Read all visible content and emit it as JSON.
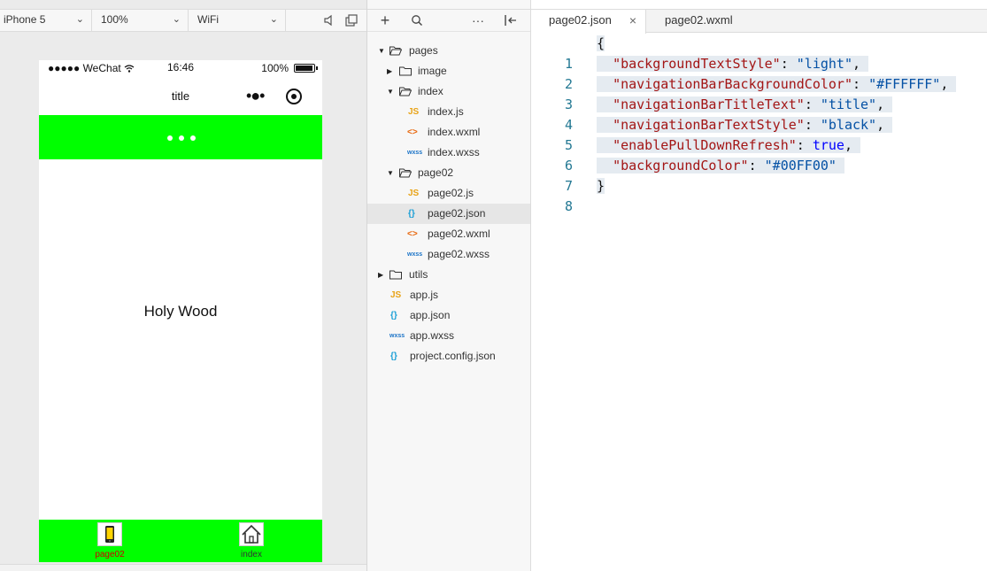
{
  "simulator": {
    "device": "iPhone 5",
    "zoom": "100%",
    "network": "WiFi",
    "statusbar": {
      "carrier": "●●●●● WeChat",
      "time": "16:46",
      "battery": "100%"
    },
    "navbar": {
      "title": "title",
      "menu_dots": "•●•"
    },
    "content_text": "Holy Wood",
    "colors": {
      "accent": "#00FF00",
      "tab_label_active": "#cc0000",
      "tab_label_inactive": "#333333"
    },
    "tabbar": [
      {
        "label": "page02",
        "icon": "phone-icon",
        "active": true
      },
      {
        "label": "index",
        "icon": "home-icon",
        "active": false
      }
    ]
  },
  "explorer": {
    "toolbar": {
      "add": "+",
      "more": "···"
    },
    "tree": [
      {
        "label": "pages",
        "type": "folder",
        "expanded": true,
        "depth": 0
      },
      {
        "label": "image",
        "type": "folder",
        "expanded": false,
        "depth": 1
      },
      {
        "label": "index",
        "type": "folder",
        "expanded": true,
        "depth": 1
      },
      {
        "label": "index.js",
        "type": "js",
        "depth": 2,
        "badge": "JS"
      },
      {
        "label": "index.wxml",
        "type": "wxml",
        "depth": 2,
        "badge": "<>"
      },
      {
        "label": "index.wxss",
        "type": "wxss",
        "depth": 2,
        "badge": "wxss"
      },
      {
        "label": "page02",
        "type": "folder",
        "expanded": true,
        "depth": 1
      },
      {
        "label": "page02.js",
        "type": "js",
        "depth": 2,
        "badge": "JS"
      },
      {
        "label": "page02.json",
        "type": "json",
        "depth": 2,
        "badge": "{}",
        "selected": true
      },
      {
        "label": "page02.wxml",
        "type": "wxml",
        "depth": 2,
        "badge": "<>"
      },
      {
        "label": "page02.wxss",
        "type": "wxss",
        "depth": 2,
        "badge": "wxss"
      },
      {
        "label": "utils",
        "type": "folder",
        "expanded": false,
        "depth": 0
      },
      {
        "label": "app.js",
        "type": "js",
        "depth": 0,
        "badge": "JS"
      },
      {
        "label": "app.json",
        "type": "json",
        "depth": 0,
        "badge": "{}"
      },
      {
        "label": "app.wxss",
        "type": "wxss",
        "depth": 0,
        "badge": "wxss"
      },
      {
        "label": "project.config.json",
        "type": "json",
        "depth": 0,
        "badge": "{}"
      }
    ]
  },
  "editor": {
    "tabs": [
      {
        "label": "page02.json",
        "active": true,
        "close": "×"
      },
      {
        "label": "page02.wxml",
        "active": false
      }
    ],
    "lines": [
      {
        "n": "1",
        "key": "",
        "value": "",
        "open": "{"
      },
      {
        "n": "2",
        "key": "\"backgroundTextStyle\"",
        "value": "\"light\"",
        "vtype": "str",
        "trail": ","
      },
      {
        "n": "3",
        "key": "\"navigationBarBackgroundColor\"",
        "value": "\"#FFFFFF\"",
        "vtype": "str",
        "trail": ","
      },
      {
        "n": "4",
        "key": "\"navigationBarTitleText\"",
        "value": "\"title\"",
        "vtype": "str",
        "trail": ","
      },
      {
        "n": "5",
        "key": "\"navigationBarTextStyle\"",
        "value": "\"black\"",
        "vtype": "str",
        "trail": ","
      },
      {
        "n": "6",
        "key": "\"enablePullDownRefresh\"",
        "value": "true",
        "vtype": "bool",
        "trail": ","
      },
      {
        "n": "7",
        "key": "\"backgroundColor\"",
        "value": "\"#00FF00\"",
        "vtype": "str",
        "trail": ""
      },
      {
        "n": "8",
        "key": "",
        "value": "",
        "open": "}"
      }
    ]
  }
}
